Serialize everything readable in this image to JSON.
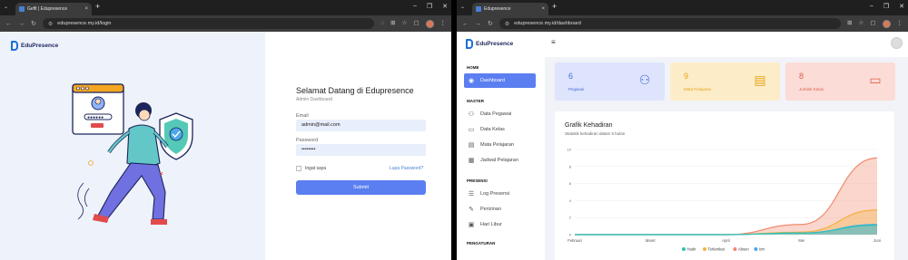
{
  "left_window": {
    "tab_title": "Geflt | Edupresence",
    "url": "edupresence.my.id/login",
    "logo": "EduPresence",
    "heading": "Selamat Datang di Edupresence",
    "subheading": "Admin Dashboard",
    "email_label": "Email",
    "email_value": "admin@mail.com",
    "password_label": "Password",
    "password_value": "••••••••",
    "remember_label": "Ingat saya",
    "forgot_label": "Lupa Password?",
    "submit_label": "Submit"
  },
  "right_window": {
    "tab_title": "Edupresence",
    "url": "edupresence.my.id/dashboard",
    "logo": "EduPresence",
    "sidebar": {
      "home_section": "HOME",
      "master_section": "MASTER",
      "presensi_section": "PRESENSI",
      "pengaturan_section": "PENGATURAN",
      "items": [
        {
          "label": "Dashboard",
          "icon": "dashboard-icon"
        },
        {
          "label": "Data Pegawai",
          "icon": "users-icon"
        },
        {
          "label": "Data Kelas",
          "icon": "class-icon"
        },
        {
          "label": "Mata Pelajaran",
          "icon": "book-icon"
        },
        {
          "label": "Jadwal Pelajaran",
          "icon": "schedule-icon"
        },
        {
          "label": "Log Presensi",
          "icon": "log-icon"
        },
        {
          "label": "Perizinan",
          "icon": "permit-icon"
        },
        {
          "label": "Hari Libur",
          "icon": "calendar-icon"
        }
      ]
    },
    "cards": [
      {
        "value": "6",
        "label": "Pegawai",
        "bg": "#dde4fb",
        "fg": "#4a6fe3"
      },
      {
        "value": "9",
        "label": "Mata Pelajaran",
        "bg": "#fdecc8",
        "fg": "#e6a417"
      },
      {
        "value": "8",
        "label": "Jumlah Kelas",
        "bg": "#fbdcd6",
        "fg": "#e0604e"
      }
    ]
  },
  "chart_data": {
    "type": "area",
    "title": "Grafik Kehadiran",
    "subtitle": "Statistik kehadiran dalam 5 bulan",
    "categories": [
      "Februari",
      "Maret",
      "April",
      "Mei",
      "Juni"
    ],
    "ylim": [
      0,
      10
    ],
    "yticks": [
      "10",
      "8",
      "6",
      "4",
      "2",
      "0"
    ],
    "series": [
      {
        "name": "Hadir",
        "values": [
          0,
          0,
          0,
          0.2,
          1.1
        ],
        "color": "#2ec4b6"
      },
      {
        "name": "Terlambat",
        "values": [
          0,
          0,
          0,
          0.3,
          2.9
        ],
        "color": "#f4b13e"
      },
      {
        "name": "Absen",
        "values": [
          0,
          0,
          0,
          1.2,
          9.0
        ],
        "color": "#f08a6e"
      },
      {
        "name": "Izin",
        "values": [
          0,
          0,
          0,
          0.2,
          1.2
        ],
        "color": "#4aa8e8"
      }
    ],
    "legend_position": "bottom"
  }
}
